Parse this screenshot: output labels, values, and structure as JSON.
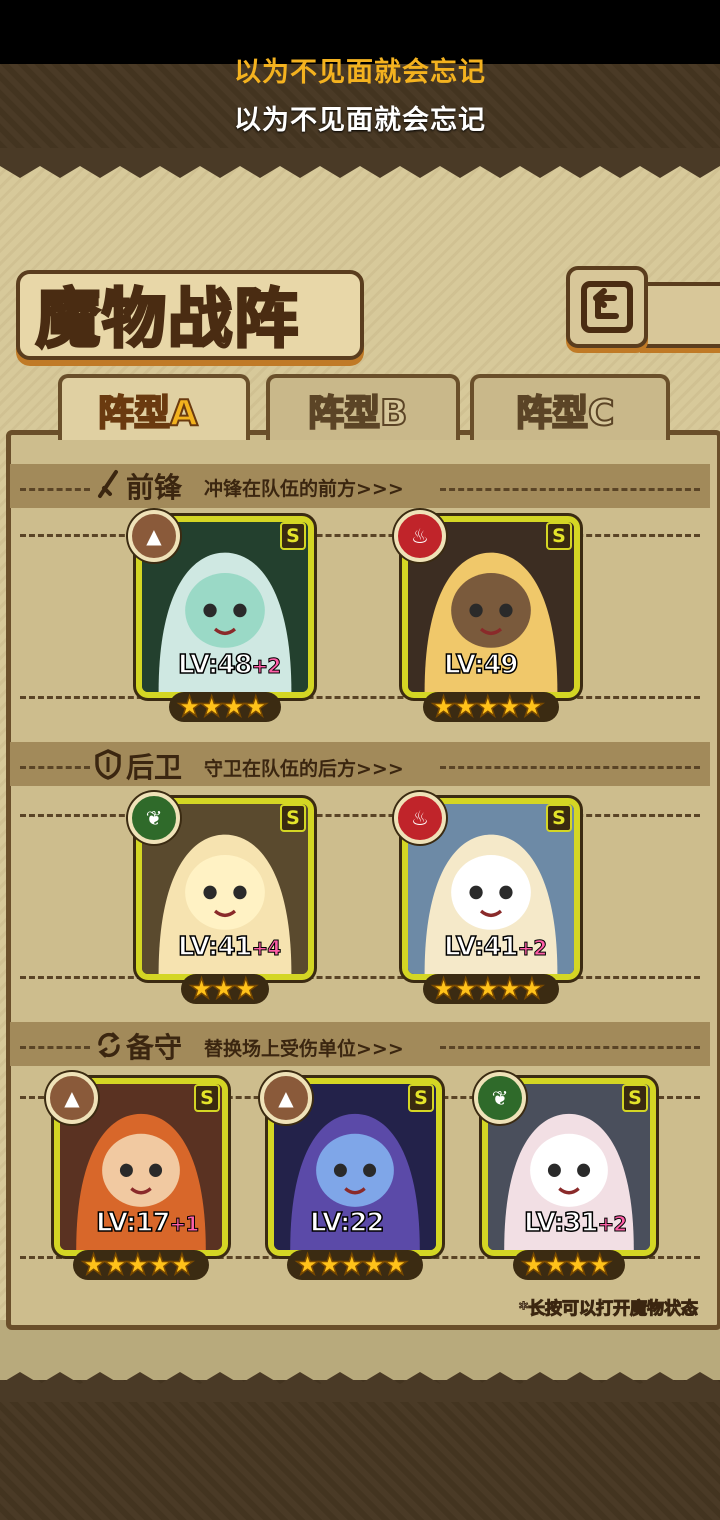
{
  "lyrics": {
    "line1": "以为不见面就会忘记",
    "line2": "以为不见面就会忘记"
  },
  "page_title": "魔物战阵",
  "back_icon": "back-arrow-icon",
  "tabs": [
    {
      "label_main": "阵型",
      "label_letter": "A",
      "active": true
    },
    {
      "label_main": "阵型",
      "label_letter": "B",
      "active": false
    },
    {
      "label_main": "阵型",
      "label_letter": "C",
      "active": false
    }
  ],
  "sections": {
    "front": {
      "icon": "sword-icon",
      "title": "前锋",
      "subtitle": "冲锋在队伍的前方>>>"
    },
    "rear": {
      "icon": "shield-icon",
      "title": "后卫",
      "subtitle": "守卫在队伍的后方>>>"
    },
    "reserve": {
      "icon": "swap-icon",
      "title": "备守",
      "subtitle": "替换场上受伤单位>>>"
    }
  },
  "colors": {
    "earth": "#8a5a3a",
    "fire": "#c0242a",
    "nature": "#2f6a2a",
    "card_border": "#d4d624",
    "accent": "#f2b21e",
    "plus": "#ff5fa8"
  },
  "monsters": [
    {
      "level": "LV:48",
      "bonus": "+2",
      "element": "earth",
      "rarity": "S",
      "stars": "★★★★"
    },
    {
      "level": "LV:49",
      "bonus": "",
      "element": "fire",
      "rarity": "S",
      "stars": "★★★★★"
    },
    {
      "level": "LV:41",
      "bonus": "+4",
      "element": "nature",
      "rarity": "S",
      "stars": "★★★"
    },
    {
      "level": "LV:41",
      "bonus": "+2",
      "element": "fire",
      "rarity": "S",
      "stars": "★★★★★"
    },
    {
      "level": "LV:17",
      "bonus": "+1",
      "element": "earth",
      "rarity": "S",
      "stars": "★★★★★"
    },
    {
      "level": "LV:22",
      "bonus": "",
      "element": "earth",
      "rarity": "S",
      "stars": "★★★★★"
    },
    {
      "level": "LV:31",
      "bonus": "+2",
      "element": "nature",
      "rarity": "S",
      "stars": "★★★★"
    }
  ],
  "hint": "*长按可以打开魔物状态"
}
